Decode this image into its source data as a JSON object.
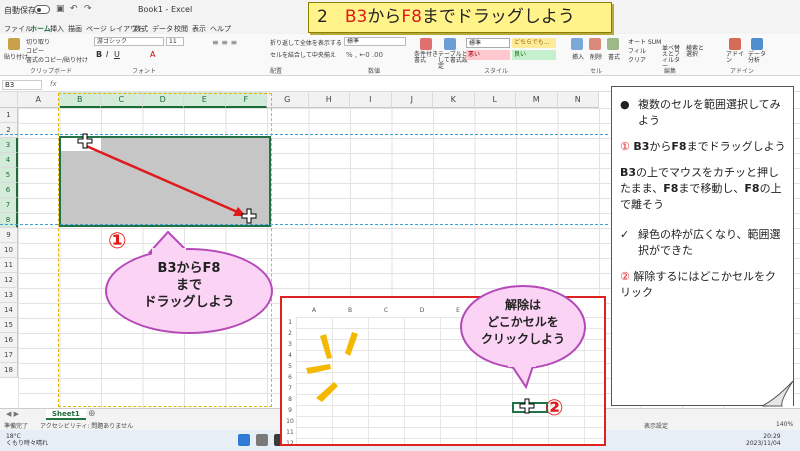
{
  "excel": {
    "autosave_label": "自動保存",
    "book_title": "Book1 - Excel",
    "tabs": [
      "ファイル",
      "ホーム",
      "挿入",
      "描画",
      "ページ レイアウト",
      "数式",
      "データ",
      "校閲",
      "表示",
      "ヘルプ"
    ],
    "active_tab": "ホーム",
    "ribbon": {
      "paste": "貼り付け",
      "cut": "切り取り",
      "copy": "コピー",
      "format_painter": "書式のコピー/貼り付け",
      "clipboard_group": "クリップボード",
      "font_name": "游ゴシック",
      "font_size": "11",
      "font_group": "フォント",
      "wrap_text": "折り返して全体を表示する",
      "merge_center": "セルを結合して中央揃え",
      "alignment_group": "配置",
      "number_format": "標準",
      "number_group": "数値",
      "conditional_format": "条件付き書式",
      "format_as_table": "テーブルとして書式設定",
      "style_standard": "標準",
      "style_neutral": "どちらでも...",
      "style_bad": "悪い",
      "style_good": "良い",
      "styles_group": "スタイル",
      "insert": "挿入",
      "delete": "削除",
      "format": "書式",
      "cells_group": "セル",
      "autosum": "オート SUM",
      "fill": "フィル",
      "clear": "クリア",
      "sort_filter": "並べ替えとフィルター",
      "find_select": "検索と選択",
      "editing_group": "編集",
      "addins": "アドイン",
      "addins_group": "アドイン",
      "data_analysis": "データ分析"
    },
    "name_box": "B3",
    "fx": "fx",
    "columns": [
      "A",
      "B",
      "C",
      "D",
      "E",
      "F",
      "G",
      "H",
      "I",
      "J",
      "K",
      "L",
      "M",
      "N"
    ],
    "rows": [
      "1",
      "2",
      "3",
      "4",
      "5",
      "6",
      "7",
      "8",
      "9",
      "10",
      "11",
      "12",
      "13",
      "14",
      "15",
      "16",
      "17",
      "18"
    ],
    "sheet_tab": "Sheet1",
    "status_ready": "準備完了",
    "accessibility": "アクセシビリティ: 問題ありません",
    "display_settings": "表示設定",
    "zoom": "140%"
  },
  "taskbar": {
    "temperature": "18°C",
    "weather": "くもり時々晴れ",
    "time": "20:29",
    "date": "2023/11/04"
  },
  "banner": {
    "prefix": "2　",
    "b3": "B3",
    "kara": "から",
    "f8": "F8",
    "suffix": "までドラッグしよう"
  },
  "callout1": {
    "line1": "B3からF8",
    "line2": "まで",
    "line3": "ドラッグしよう"
  },
  "marker1": "①",
  "marker2": "②",
  "callout2": {
    "line1": "解除は",
    "line2": "どこかセルを",
    "line3": "クリックしよう"
  },
  "inset": {
    "columns": [
      "A",
      "B",
      "C",
      "D",
      "E",
      "F",
      "G",
      "H"
    ],
    "rows": [
      "1",
      "2",
      "3",
      "4",
      "5",
      "6",
      "7",
      "8",
      "9",
      "10",
      "11",
      "12"
    ]
  },
  "side_panel": {
    "item1_mark": "●",
    "item1_text": "複数のセルを範囲選択してみよう",
    "item2_num": "①",
    "item2_b3": "B3",
    "item2_kara": "から",
    "item2_f8": "F8",
    "item2_rest": "までドラッグしよう",
    "item3_b3": "B3",
    "item3_a": "の上でマウスをカチッと押したまま、",
    "item3_f8a": "F8",
    "item3_b": "まで移動し、",
    "item3_f8b": "F8",
    "item3_c": "の上で離そう",
    "item4_mark": "✓",
    "item4_text": "緑色の枠が広くなり、範囲選択ができた",
    "item5_num": "②",
    "item5_text": "解除するにはどこかセルをクリック"
  },
  "colors": {
    "accent_red": "#e01a1a",
    "excel_green": "#217346",
    "banner_yellow": "#fff38a",
    "callout_pink": "#fbd3f5",
    "guide_blue": "#3aa0d8",
    "guide_gold": "#e3b400"
  }
}
